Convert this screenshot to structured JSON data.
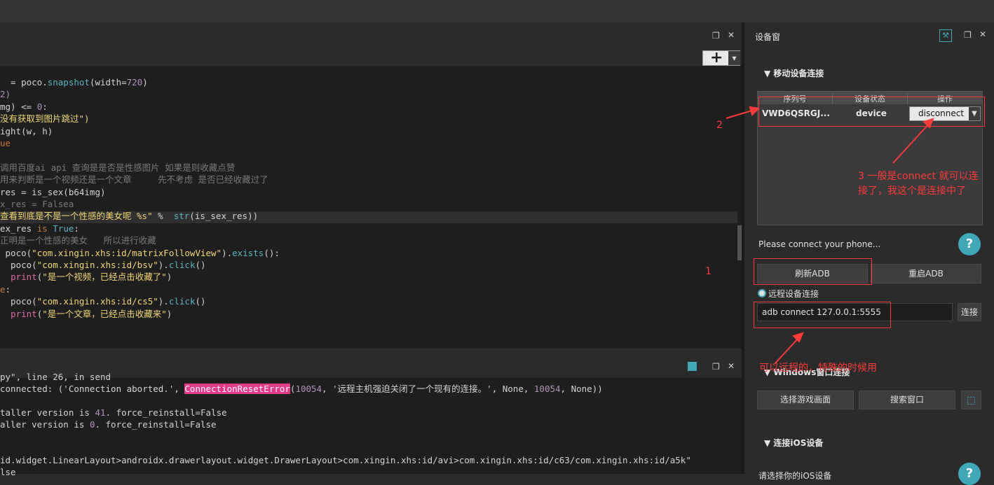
{
  "editor": {
    "lines": [
      {
        "indent": "",
        "parts": [
          {
            "t": "  = poco.",
            "c": ""
          },
          {
            "t": "snapshot",
            "c": "fn"
          },
          {
            "t": "(width=",
            "c": ""
          },
          {
            "t": "720",
            "c": "num"
          },
          {
            "t": ")",
            "c": ""
          }
        ]
      },
      {
        "indent": "",
        "parts": [
          {
            "t": "2)",
            "c": "num"
          }
        ]
      },
      {
        "indent": "",
        "parts": [
          {
            "t": "mg) <= ",
            "c": ""
          },
          {
            "t": "0",
            "c": "num"
          },
          {
            "t": ":",
            "c": ""
          }
        ]
      },
      {
        "indent": "",
        "parts": [
          {
            "t": "没有获取到图片跳过\")",
            "c": "str"
          }
        ]
      },
      {
        "indent": "",
        "parts": [
          {
            "t": "ight(w, h)",
            "c": ""
          }
        ]
      },
      {
        "indent": "",
        "parts": [
          {
            "t": "ue",
            "c": "kw"
          }
        ]
      },
      {
        "indent": "",
        "parts": [
          {
            "t": "",
            "c": ""
          }
        ]
      },
      {
        "indent": "",
        "parts": [
          {
            "t": "调用百度ai api 查询是是否是性感图片 如果是则收藏点赞",
            "c": "cm"
          }
        ]
      },
      {
        "indent": "",
        "parts": [
          {
            "t": "用来判断是一个视频还是一个文章     先不考虑 是否已经收藏过了",
            "c": "cm"
          }
        ]
      },
      {
        "indent": "",
        "parts": [
          {
            "t": "res = is_sex(b64img)",
            "c": ""
          }
        ]
      },
      {
        "indent": "",
        "parts": [
          {
            "t": "x_res = Falsea",
            "c": "cm"
          }
        ]
      },
      {
        "indent": "",
        "parts": [
          {
            "t": "查看到底是不是一个性感的美女呢 %s\" ",
            "c": "str"
          },
          {
            "t": "%  ",
            "c": ""
          },
          {
            "t": "str",
            "c": "fn"
          },
          {
            "t": "(is_sex_res))",
            "c": ""
          }
        ]
      },
      {
        "indent": "",
        "parts": [
          {
            "t": "ex_res ",
            "c": ""
          },
          {
            "t": "is",
            "c": "kw"
          },
          {
            "t": " True",
            "c": "fn"
          },
          {
            "t": ":",
            "c": ""
          }
        ]
      },
      {
        "indent": "",
        "parts": [
          {
            "t": "正明是一个性感的美女   所以进行收藏",
            "c": "cm"
          }
        ]
      },
      {
        "indent": "",
        "parts": [
          {
            "t": " poco(",
            "c": ""
          },
          {
            "t": "\"com.xingin.xhs:id/matrixFollowView\"",
            "c": "str"
          },
          {
            "t": ").",
            "c": ""
          },
          {
            "t": "exists",
            "c": "fn"
          },
          {
            "t": "():",
            "c": ""
          }
        ]
      },
      {
        "indent": "",
        "parts": [
          {
            "t": "  poco(",
            "c": ""
          },
          {
            "t": "\"com.xingin.xhs:id/bsv\"",
            "c": "str"
          },
          {
            "t": ").",
            "c": ""
          },
          {
            "t": "click",
            "c": "fn"
          },
          {
            "t": "()",
            "c": ""
          }
        ]
      },
      {
        "indent": "",
        "parts": [
          {
            "t": "  ",
            "c": ""
          },
          {
            "t": "print",
            "c": "pink"
          },
          {
            "t": "(",
            "c": ""
          },
          {
            "t": "\"是一个视频，已经点击收藏了\"",
            "c": "str"
          },
          {
            "t": ")",
            "c": ""
          }
        ]
      },
      {
        "indent": "",
        "parts": [
          {
            "t": "e",
            "c": "kw"
          },
          {
            "t": ":",
            "c": ""
          }
        ]
      },
      {
        "indent": "",
        "parts": [
          {
            "t": "  poco(",
            "c": ""
          },
          {
            "t": "\"com.xingin.xhs:id/cs5\"",
            "c": "str"
          },
          {
            "t": ").",
            "c": ""
          },
          {
            "t": "click",
            "c": "fn"
          },
          {
            "t": "()",
            "c": ""
          }
        ]
      },
      {
        "indent": "",
        "parts": [
          {
            "t": "  ",
            "c": ""
          },
          {
            "t": "print",
            "c": "pink"
          },
          {
            "t": "(",
            "c": ""
          },
          {
            "t": "\"是一个文章，已经点击收藏来\"",
            "c": "str"
          },
          {
            "t": ")",
            "c": ""
          }
        ]
      }
    ],
    "add_button": "+",
    "dropdown": "▾"
  },
  "console": {
    "lines": [
      {
        "parts": [
          {
            "t": "py\", line 26, in send",
            "c": ""
          }
        ]
      },
      {
        "parts": [
          {
            "t": "connected: ('Connection aborted.', ",
            "c": ""
          },
          {
            "t": "ConnectionResetError",
            "c": "hl"
          },
          {
            "t": "(",
            "c": ""
          },
          {
            "t": "10054",
            "c": "num"
          },
          {
            "t": ", '远程主机强迫关闭了一个现有的连接。', None, ",
            "c": ""
          },
          {
            "t": "10054",
            "c": "num"
          },
          {
            "t": ", None))",
            "c": ""
          }
        ]
      },
      {
        "parts": [
          {
            "t": "",
            "c": ""
          }
        ]
      },
      {
        "parts": [
          {
            "t": "taller version is ",
            "c": ""
          },
          {
            "t": "41",
            "c": "num"
          },
          {
            "t": ". force_reinstall=False",
            "c": ""
          }
        ]
      },
      {
        "parts": [
          {
            "t": "aller version is ",
            "c": ""
          },
          {
            "t": "0",
            "c": "num"
          },
          {
            "t": ". force_reinstall=False",
            "c": ""
          }
        ]
      },
      {
        "parts": [
          {
            "t": "",
            "c": ""
          }
        ]
      },
      {
        "parts": [
          {
            "t": "",
            "c": ""
          }
        ]
      },
      {
        "parts": [
          {
            "t": "id.widget.LinearLayout>androidx.drawerlayout.widget.DrawerLayout>com.xingin.xhs:id/avi>com.xingin.xhs:id/c63/com.xingin.xhs:id/a5k\"",
            "c": ""
          }
        ]
      },
      {
        "parts": [
          {
            "t": "lse",
            "c": ""
          }
        ]
      }
    ]
  },
  "device_panel": {
    "title": "设备窗",
    "mobile_section": "移动设备连接",
    "table_headers": [
      "序列号",
      "设备状态",
      "操作"
    ],
    "row": {
      "serial": "VWD6QSRGJ...",
      "status": "device",
      "action": "disconnect"
    },
    "connect_prompt": "Please connect your phone...",
    "refresh_adb": "刷新ADB",
    "restart_adb": "重启ADB",
    "remote_label": "远程设备连接",
    "remote_value": "adb connect 127.0.0.1:5555",
    "connect_button": "连接",
    "windows_section": "Windows窗口连接",
    "select_game": "选择游戏画面",
    "search_window": "搜索窗口",
    "ios_section": "连接iOS设备",
    "ios_hint": "请选择你的iOS设备"
  },
  "annotations": {
    "num1": "1",
    "num2": "2",
    "note3": "3 一般是connect 就可以连接了，我这个是连接中了",
    "remote_note": "可以远程的，特殊的时候用"
  },
  "colors": {
    "annotation": "#ff3b3b",
    "accent": "#3fa7b8"
  }
}
